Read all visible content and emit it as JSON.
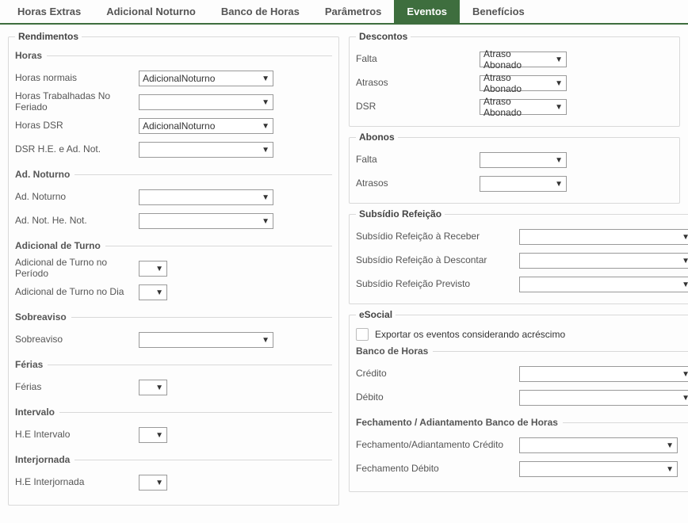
{
  "tabs": {
    "items": [
      {
        "label": "Horas Extras",
        "active": false
      },
      {
        "label": "Adicional Noturno",
        "active": false
      },
      {
        "label": "Banco de Horas",
        "active": false
      },
      {
        "label": "Parâmetros",
        "active": false
      },
      {
        "label": "Eventos",
        "active": true
      },
      {
        "label": "Benefícios",
        "active": false
      }
    ]
  },
  "rendimentos": {
    "legend": "Rendimentos",
    "horas": {
      "legend": "Horas",
      "normais_label": "Horas normais",
      "normais_value": "AdicionalNoturno",
      "trabalhadas_feriado_label": "Horas Trabalhadas No Feriado",
      "trabalhadas_feriado_value": "",
      "dsr_label": "Horas DSR",
      "dsr_value": "AdicionalNoturno",
      "dsr_he_adnot_label": "DSR H.E. e Ad. Not.",
      "dsr_he_adnot_value": ""
    },
    "ad_noturno": {
      "legend": "Ad. Noturno",
      "ad_noturno_label": "Ad. Noturno",
      "ad_noturno_value": "",
      "ad_not_he_not_label": "Ad. Not. He. Not.",
      "ad_not_he_not_value": ""
    },
    "adicional_turno": {
      "legend": "Adicional de Turno",
      "periodo_label": "Adicional de Turno no Período",
      "periodo_value": "",
      "dia_label": "Adicional de Turno no Dia",
      "dia_value": ""
    },
    "sobreaviso": {
      "legend": "Sobreaviso",
      "label": "Sobreaviso",
      "value": ""
    },
    "ferias": {
      "legend": "Férias",
      "label": "Férias",
      "value": ""
    },
    "intervalo": {
      "legend": "Intervalo",
      "label": "H.E Intervalo",
      "value": ""
    },
    "interjornada": {
      "legend": "Interjornada",
      "label": "H.E Interjornada",
      "value": ""
    }
  },
  "descontos": {
    "legend": "Descontos",
    "falta_label": "Falta",
    "falta_value": "Atraso Abonado",
    "atrasos_label": "Atrasos",
    "atrasos_value": "Atraso Abonado",
    "dsr_label": "DSR",
    "dsr_value": "Atraso Abonado"
  },
  "abonos": {
    "legend": "Abonos",
    "falta_label": "Falta",
    "falta_value": "",
    "atrasos_label": "Atrasos",
    "atrasos_value": ""
  },
  "subsidio": {
    "legend": "Subsídio Refeição",
    "receber_label": "Subsídio Refeição à Receber",
    "receber_value": "",
    "descontar_label": "Subsídio Refeição à Descontar",
    "descontar_value": "",
    "previsto_label": "Subsídio Refeição Previsto",
    "previsto_value": ""
  },
  "esocial": {
    "legend": "eSocial",
    "exportar_label": "Exportar os eventos considerando acréscimo",
    "banco_horas": {
      "legend": "Banco de Horas",
      "credito_label": "Crédito",
      "credito_value": "",
      "debito_label": "Débito",
      "debito_value": ""
    },
    "fechamento": {
      "legend": "Fechamento / Adiantamento Banco de Horas",
      "credito_label": "Fechamento/Adiantamento Crédito",
      "credito_value": "",
      "debito_label": "Fechamento Débito",
      "debito_value": ""
    }
  }
}
